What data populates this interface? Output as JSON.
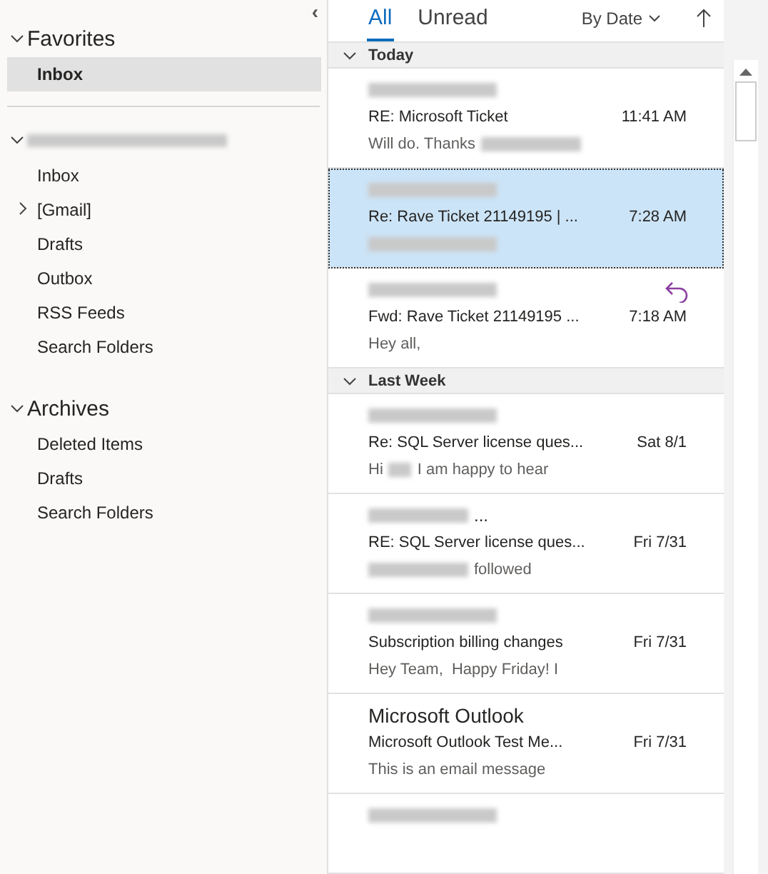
{
  "folders": {
    "collapse_glyph": "‹",
    "favorites": {
      "title": "Favorites",
      "expanded": true,
      "items": [
        {
          "label": "Inbox",
          "selected": true
        }
      ]
    },
    "account": {
      "expanded": true,
      "items": [
        {
          "label": "Inbox",
          "selected": false,
          "has_children": false
        },
        {
          "label": "[Gmail]",
          "selected": false,
          "has_children": true
        },
        {
          "label": "Drafts",
          "selected": false,
          "has_children": false
        },
        {
          "label": "Outbox",
          "selected": false,
          "has_children": false
        },
        {
          "label": "RSS Feeds",
          "selected": false,
          "has_children": false
        },
        {
          "label": "Search Folders",
          "selected": false,
          "has_children": false
        }
      ]
    },
    "archives": {
      "title": "Archives",
      "expanded": true,
      "items": [
        {
          "label": "Deleted Items",
          "selected": false
        },
        {
          "label": "Drafts",
          "selected": false
        },
        {
          "label": "Search Folders",
          "selected": false
        }
      ]
    }
  },
  "filters": [
    {
      "label": "All",
      "selected": true
    },
    {
      "label": "Unread",
      "selected": false
    }
  ],
  "sort": {
    "label": "By Date"
  },
  "groups": [
    {
      "title": "Today",
      "expanded": true,
      "messages": [
        {
          "sender": [
            {
              "kind": "redacted"
            }
          ],
          "subject": "RE: Microsoft Ticket",
          "time": "11:41 AM",
          "preview": [
            {
              "kind": "text",
              "text": "Will do. Thanks"
            },
            {
              "kind": "redacted"
            }
          ],
          "selected": false,
          "replied": false
        },
        {
          "sender": [
            {
              "kind": "redacted"
            }
          ],
          "subject": "Re: Rave Ticket 21149195 | ...",
          "time": "7:28 AM",
          "preview": [
            {
              "kind": "redacted"
            }
          ],
          "selected": true,
          "replied": false
        },
        {
          "sender": [
            {
              "kind": "redacted"
            }
          ],
          "subject": "Fwd: Rave Ticket 21149195 ...",
          "time": "7:18 AM",
          "preview": [
            {
              "kind": "text",
              "text": "Hey all,"
            }
          ],
          "selected": false,
          "replied": true
        }
      ]
    },
    {
      "title": "Last Week",
      "expanded": true,
      "messages": [
        {
          "sender": [
            {
              "kind": "redacted"
            }
          ],
          "subject": "Re: SQL Server license ques...",
          "time": "Sat 8/1",
          "preview": [
            {
              "kind": "text",
              "text": "Hi"
            },
            {
              "kind": "redacted"
            },
            {
              "kind": "text",
              "text": "I am happy to hear"
            }
          ],
          "selected": false,
          "replied": false
        },
        {
          "sender": [
            {
              "kind": "redacted"
            },
            {
              "kind": "text",
              "text": "..."
            }
          ],
          "subject": "RE: SQL Server license ques...",
          "time": "Fri 7/31",
          "preview": [
            {
              "kind": "redacted"
            },
            {
              "kind": "text",
              "text": "followed"
            }
          ],
          "selected": false,
          "replied": false
        },
        {
          "sender": [
            {
              "kind": "redacted"
            }
          ],
          "subject": "Subscription billing changes",
          "time": "Fri 7/31",
          "preview": [
            {
              "kind": "text",
              "text": "Hey Team,  Happy Friday! I"
            }
          ],
          "selected": false,
          "replied": false
        },
        {
          "sender": [
            {
              "kind": "text",
              "text": "Microsoft Outlook"
            }
          ],
          "subject": "Microsoft Outlook Test Me...",
          "time": "Fri 7/31",
          "preview": [
            {
              "kind": "text",
              "text": "This is an email message"
            }
          ],
          "selected": false,
          "replied": false
        },
        {
          "sender": [
            {
              "kind": "redacted"
            }
          ],
          "selected": false,
          "replied": false
        }
      ]
    }
  ]
}
